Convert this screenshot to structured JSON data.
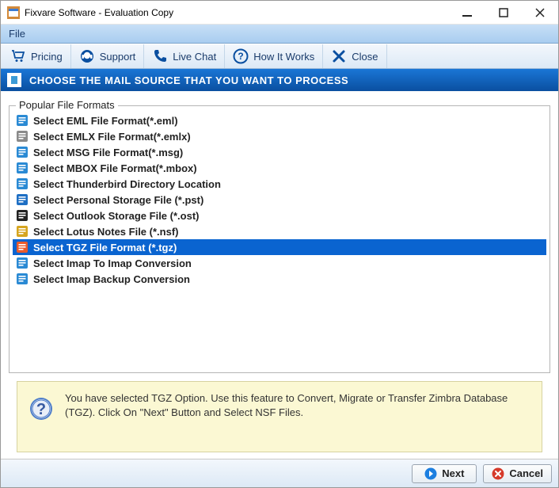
{
  "window": {
    "title": "Fixvare Software - Evaluation Copy"
  },
  "menubar": {
    "file": "File"
  },
  "toolbar": {
    "pricing": "Pricing",
    "support": "Support",
    "livechat": "Live Chat",
    "howitworks": "How It Works",
    "close": "Close"
  },
  "banner": {
    "text": "CHOOSE THE MAIL SOURCE THAT YOU WANT TO PROCESS"
  },
  "group": {
    "title": "Popular File Formats"
  },
  "formats": [
    {
      "label": "Select EML File Format(*.eml)"
    },
    {
      "label": "Select EMLX File Format(*.emlx)"
    },
    {
      "label": "Select MSG File Format(*.msg)"
    },
    {
      "label": "Select MBOX File Format(*.mbox)"
    },
    {
      "label": "Select Thunderbird Directory Location"
    },
    {
      "label": "Select Personal Storage File (*.pst)"
    },
    {
      "label": "Select Outlook Storage File (*.ost)"
    },
    {
      "label": "Select Lotus Notes File (*.nsf)"
    },
    {
      "label": "Select TGZ File Format (*.tgz)"
    },
    {
      "label": "Select Imap To Imap Conversion"
    },
    {
      "label": "Select Imap Backup Conversion"
    }
  ],
  "selected_index": 8,
  "info": {
    "text": "You have selected TGZ Option. Use this feature to Convert, Migrate or Transfer Zimbra Database (TGZ). Click On \"Next\" Button and Select NSF Files."
  },
  "footer": {
    "next": "Next",
    "cancel": "Cancel"
  }
}
